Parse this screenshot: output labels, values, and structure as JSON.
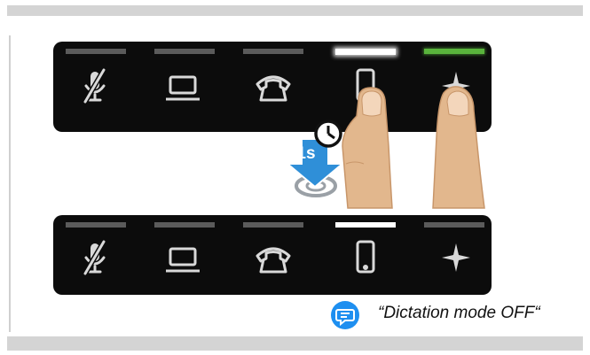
{
  "caption": {
    "text": "“Dictation mode OFF“"
  },
  "hold_badge": {
    "text": "1s"
  },
  "buttons": [
    {
      "name": "mic-mute",
      "icon": "microphone-muted-icon"
    },
    {
      "name": "laptop",
      "icon": "laptop-icon"
    },
    {
      "name": "phone",
      "icon": "telephone-icon"
    },
    {
      "name": "smartphone",
      "icon": "smartphone-icon"
    },
    {
      "name": "sparkle",
      "icon": "sparkle-icon"
    }
  ],
  "top_panel_state": [
    "grey",
    "grey",
    "grey",
    "white-glow",
    "green"
  ],
  "bottom_panel_state": [
    "grey",
    "grey",
    "grey",
    "white",
    "grey"
  ],
  "colors": {
    "panel": "#0c0c0c",
    "indicator_off": "#5b5b5b",
    "indicator_on": "#ffffff",
    "indicator_green": "#59b33c",
    "arrow_blue": "#2f8fd8",
    "chat_blue": "#1e8ff0",
    "skin": "#e2b78d"
  }
}
